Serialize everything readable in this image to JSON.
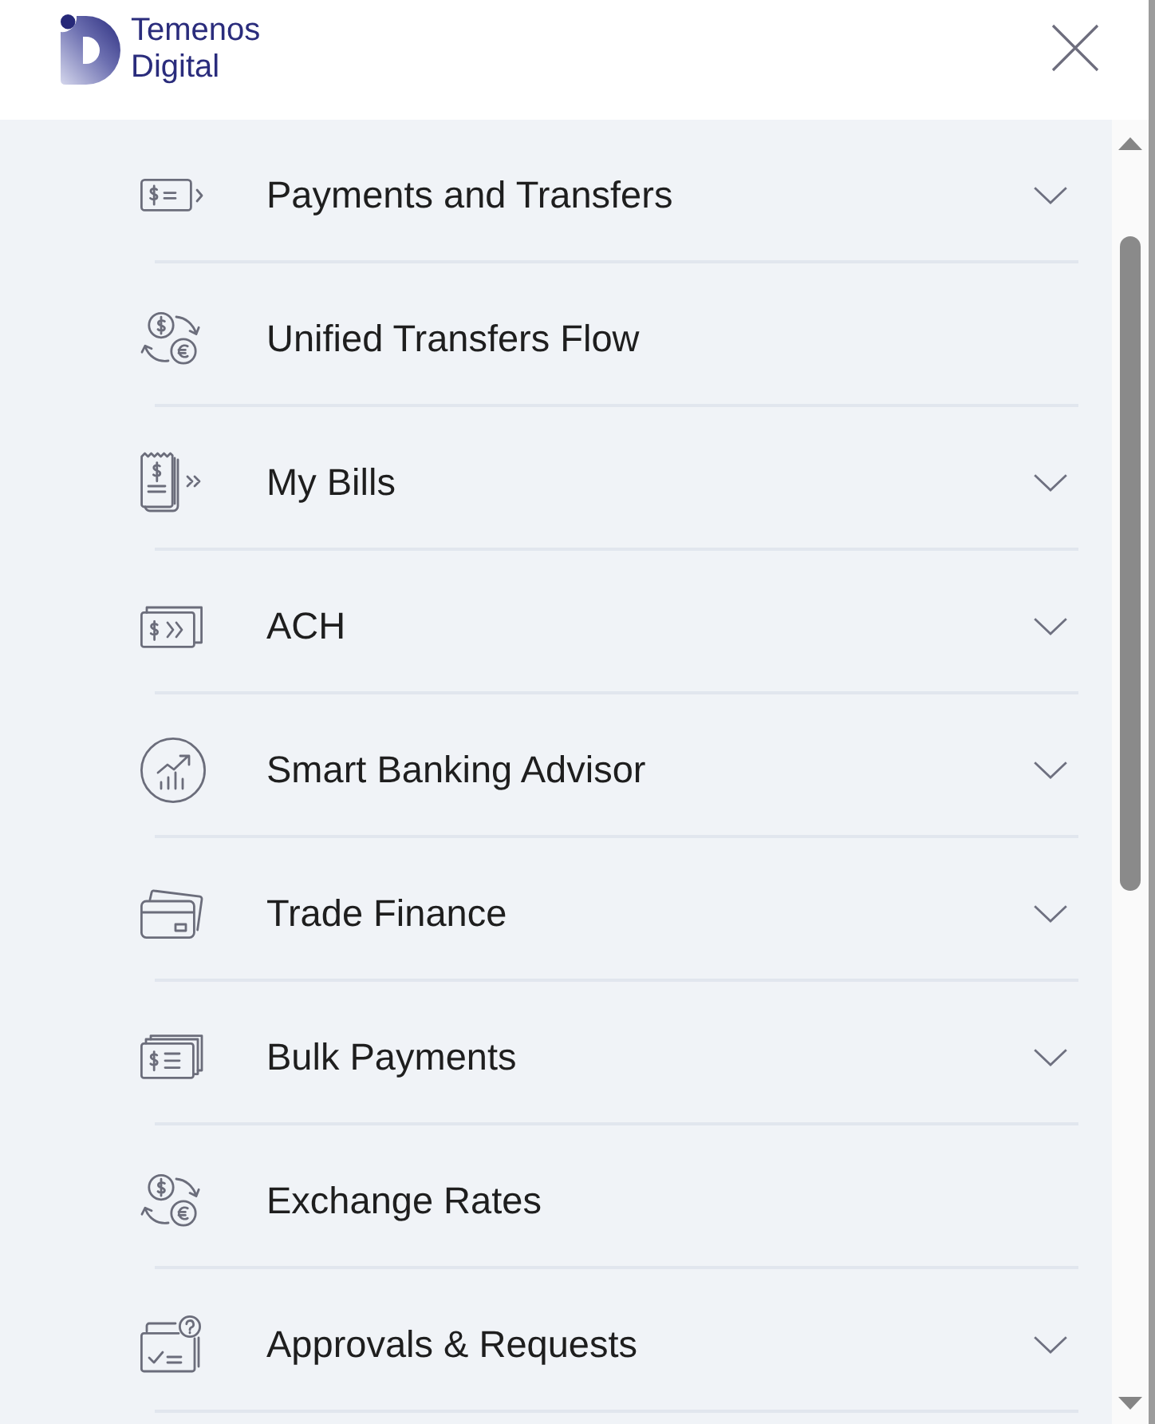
{
  "header": {
    "logo": {
      "line_1": "Temenos",
      "line_2": "Digital"
    }
  },
  "menu": {
    "items": [
      {
        "label": "Payments and Transfers",
        "kind": "submenu"
      },
      {
        "label": "Unified Transfers Flow",
        "kind": "link"
      },
      {
        "label": "My Bills",
        "kind": "submenu"
      },
      {
        "label": "ACH",
        "kind": "submenu"
      },
      {
        "label": "Smart Banking Advisor",
        "kind": "submenu"
      },
      {
        "label": "Trade Finance",
        "kind": "submenu"
      },
      {
        "label": "Bulk Payments",
        "kind": "submenu"
      },
      {
        "label": "Exchange Rates",
        "kind": "link"
      },
      {
        "label": "Approvals & Requests",
        "kind": "submenu"
      }
    ]
  }
}
